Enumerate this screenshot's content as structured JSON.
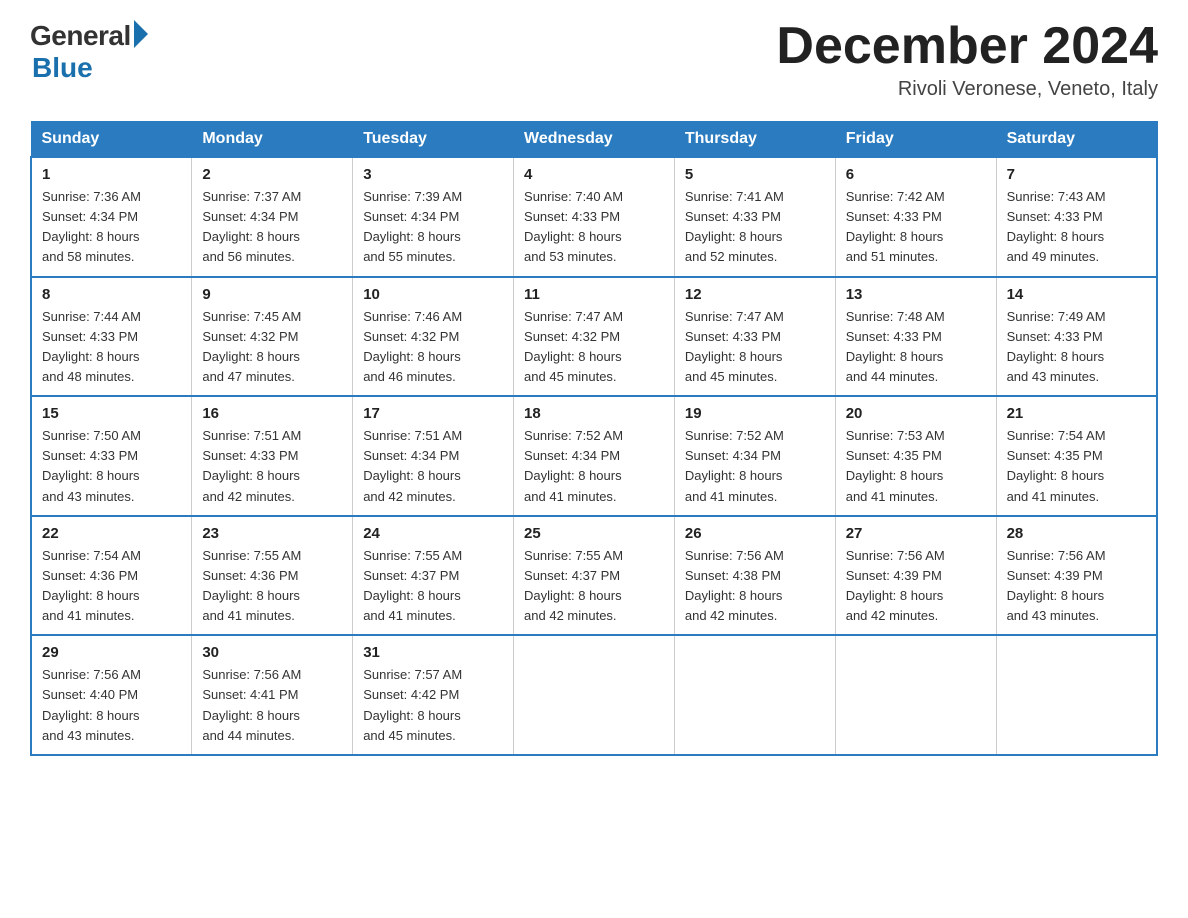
{
  "logo": {
    "general": "General",
    "blue": "Blue"
  },
  "title": "December 2024",
  "location": "Rivoli Veronese, Veneto, Italy",
  "days_of_week": [
    "Sunday",
    "Monday",
    "Tuesday",
    "Wednesday",
    "Thursday",
    "Friday",
    "Saturday"
  ],
  "weeks": [
    [
      {
        "day": "1",
        "sunrise": "7:36 AM",
        "sunset": "4:34 PM",
        "daylight": "8 hours and 58 minutes."
      },
      {
        "day": "2",
        "sunrise": "7:37 AM",
        "sunset": "4:34 PM",
        "daylight": "8 hours and 56 minutes."
      },
      {
        "day": "3",
        "sunrise": "7:39 AM",
        "sunset": "4:34 PM",
        "daylight": "8 hours and 55 minutes."
      },
      {
        "day": "4",
        "sunrise": "7:40 AM",
        "sunset": "4:33 PM",
        "daylight": "8 hours and 53 minutes."
      },
      {
        "day": "5",
        "sunrise": "7:41 AM",
        "sunset": "4:33 PM",
        "daylight": "8 hours and 52 minutes."
      },
      {
        "day": "6",
        "sunrise": "7:42 AM",
        "sunset": "4:33 PM",
        "daylight": "8 hours and 51 minutes."
      },
      {
        "day": "7",
        "sunrise": "7:43 AM",
        "sunset": "4:33 PM",
        "daylight": "8 hours and 49 minutes."
      }
    ],
    [
      {
        "day": "8",
        "sunrise": "7:44 AM",
        "sunset": "4:33 PM",
        "daylight": "8 hours and 48 minutes."
      },
      {
        "day": "9",
        "sunrise": "7:45 AM",
        "sunset": "4:32 PM",
        "daylight": "8 hours and 47 minutes."
      },
      {
        "day": "10",
        "sunrise": "7:46 AM",
        "sunset": "4:32 PM",
        "daylight": "8 hours and 46 minutes."
      },
      {
        "day": "11",
        "sunrise": "7:47 AM",
        "sunset": "4:32 PM",
        "daylight": "8 hours and 45 minutes."
      },
      {
        "day": "12",
        "sunrise": "7:47 AM",
        "sunset": "4:33 PM",
        "daylight": "8 hours and 45 minutes."
      },
      {
        "day": "13",
        "sunrise": "7:48 AM",
        "sunset": "4:33 PM",
        "daylight": "8 hours and 44 minutes."
      },
      {
        "day": "14",
        "sunrise": "7:49 AM",
        "sunset": "4:33 PM",
        "daylight": "8 hours and 43 minutes."
      }
    ],
    [
      {
        "day": "15",
        "sunrise": "7:50 AM",
        "sunset": "4:33 PM",
        "daylight": "8 hours and 43 minutes."
      },
      {
        "day": "16",
        "sunrise": "7:51 AM",
        "sunset": "4:33 PM",
        "daylight": "8 hours and 42 minutes."
      },
      {
        "day": "17",
        "sunrise": "7:51 AM",
        "sunset": "4:34 PM",
        "daylight": "8 hours and 42 minutes."
      },
      {
        "day": "18",
        "sunrise": "7:52 AM",
        "sunset": "4:34 PM",
        "daylight": "8 hours and 41 minutes."
      },
      {
        "day": "19",
        "sunrise": "7:52 AM",
        "sunset": "4:34 PM",
        "daylight": "8 hours and 41 minutes."
      },
      {
        "day": "20",
        "sunrise": "7:53 AM",
        "sunset": "4:35 PM",
        "daylight": "8 hours and 41 minutes."
      },
      {
        "day": "21",
        "sunrise": "7:54 AM",
        "sunset": "4:35 PM",
        "daylight": "8 hours and 41 minutes."
      }
    ],
    [
      {
        "day": "22",
        "sunrise": "7:54 AM",
        "sunset": "4:36 PM",
        "daylight": "8 hours and 41 minutes."
      },
      {
        "day": "23",
        "sunrise": "7:55 AM",
        "sunset": "4:36 PM",
        "daylight": "8 hours and 41 minutes."
      },
      {
        "day": "24",
        "sunrise": "7:55 AM",
        "sunset": "4:37 PM",
        "daylight": "8 hours and 41 minutes."
      },
      {
        "day": "25",
        "sunrise": "7:55 AM",
        "sunset": "4:37 PM",
        "daylight": "8 hours and 42 minutes."
      },
      {
        "day": "26",
        "sunrise": "7:56 AM",
        "sunset": "4:38 PM",
        "daylight": "8 hours and 42 minutes."
      },
      {
        "day": "27",
        "sunrise": "7:56 AM",
        "sunset": "4:39 PM",
        "daylight": "8 hours and 42 minutes."
      },
      {
        "day": "28",
        "sunrise": "7:56 AM",
        "sunset": "4:39 PM",
        "daylight": "8 hours and 43 minutes."
      }
    ],
    [
      {
        "day": "29",
        "sunrise": "7:56 AM",
        "sunset": "4:40 PM",
        "daylight": "8 hours and 43 minutes."
      },
      {
        "day": "30",
        "sunrise": "7:56 AM",
        "sunset": "4:41 PM",
        "daylight": "8 hours and 44 minutes."
      },
      {
        "day": "31",
        "sunrise": "7:57 AM",
        "sunset": "4:42 PM",
        "daylight": "8 hours and 45 minutes."
      },
      {
        "day": "",
        "sunrise": "",
        "sunset": "",
        "daylight": ""
      },
      {
        "day": "",
        "sunrise": "",
        "sunset": "",
        "daylight": ""
      },
      {
        "day": "",
        "sunrise": "",
        "sunset": "",
        "daylight": ""
      },
      {
        "day": "",
        "sunrise": "",
        "sunset": "",
        "daylight": ""
      }
    ]
  ],
  "labels": {
    "sunrise": "Sunrise: ",
    "sunset": "Sunset: ",
    "daylight": "Daylight: "
  }
}
